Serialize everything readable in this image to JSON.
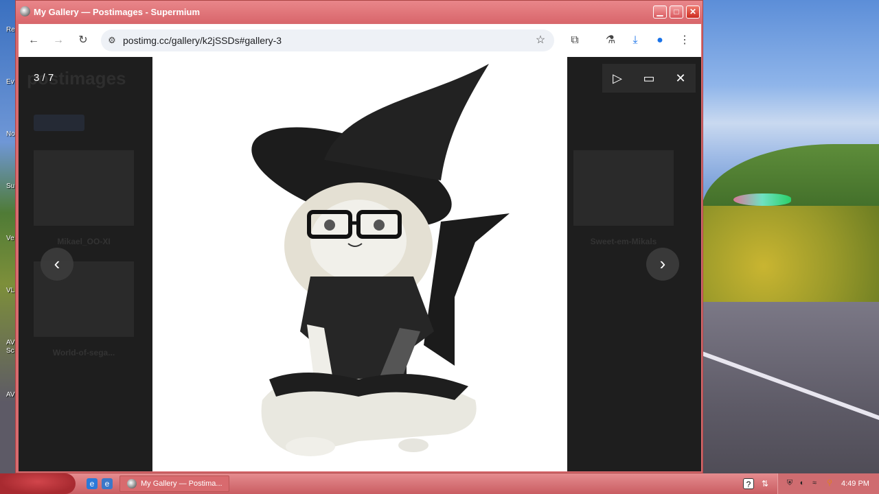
{
  "window": {
    "title": "My Gallery — Postimages - Supermium",
    "minimize": "▁",
    "maximize": "□",
    "close": "✕"
  },
  "toolbar": {
    "url": "postimg.cc/gallery/k2jSSDs#gallery-3",
    "back_icon": "←",
    "forward_icon": "→",
    "reload_icon": "↻",
    "site_info_icon": "⚙",
    "star_icon": "☆",
    "extensions_icon": "⧉",
    "labs_icon": "⚗",
    "download_icon": "⤓",
    "profile_icon": "●",
    "menu_icon": "⋮"
  },
  "background_page": {
    "logo": "postimages",
    "thumbnails": [
      {
        "caption": "Mikael_OO-XI"
      },
      {
        "caption": "World-of-sega..."
      },
      {
        "caption": "Sweet-em-Mikals"
      }
    ]
  },
  "lightbox": {
    "counter": "3 / 7",
    "play_icon": "▷",
    "fullscreen_icon": "▭",
    "close_icon": "✕",
    "prev_icon": "‹",
    "next_icon": "›"
  },
  "desktop": {
    "icon_labels": [
      "Re",
      "Ev",
      "No",
      "Su",
      "Ve",
      "VL",
      "AV Sc",
      "AV"
    ]
  },
  "taskbar": {
    "task_label": "My Gallery — Postima...",
    "clock": "4:49 PM"
  },
  "colors": {
    "title_bar": "#d9676c",
    "lightbox_bg": "#1e1e1e",
    "taskbar": "#c95d62"
  }
}
